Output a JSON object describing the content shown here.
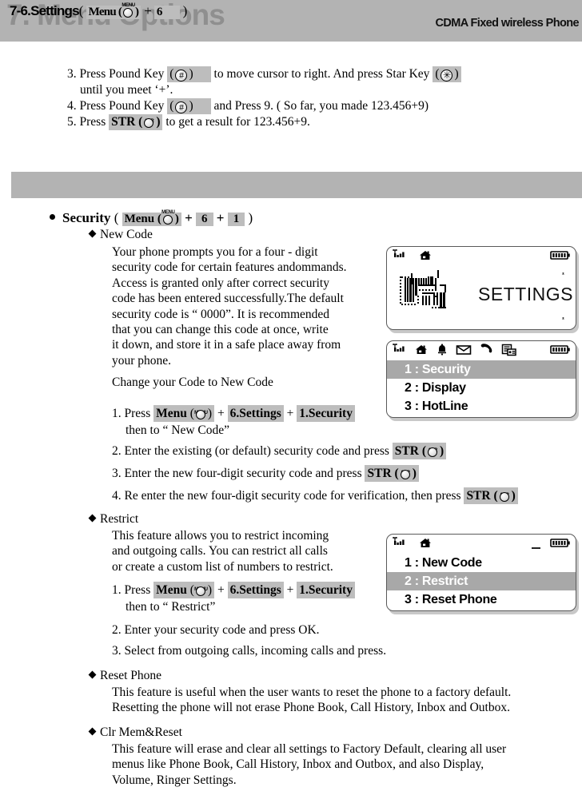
{
  "header": {
    "title": "7. Menu Options",
    "subtitle": "CDMA Fixed wireless Phone",
    "bar_color": "#b3b3b3",
    "title_color": "#8f8f8f"
  },
  "top_steps": {
    "step3_a": "3. Press Pound Key",
    "step3_b": "to move cursor to right.  And press Star Key",
    "step3_cont": "until you meet ‘+’.",
    "step4_a": "4. Press Pound Key",
    "step4_b": "and Press 9. ( So far, you made 123.456+9)",
    "step5_a": "5. Press",
    "step5_b": "to get a result for 123.456+9.",
    "pound_symbol": "#",
    "star_symbol": "✳",
    "str_label": "STR",
    "str_key_cap": "STR"
  },
  "section_band": {
    "title": "7-6.Settings",
    "open_paren": "(",
    "menu_label": "Menu",
    "menu_key_cap": "MENU",
    "plus": "+",
    "number": "6",
    "close_paren": ")"
  },
  "security": {
    "heading": "Security",
    "open_paren": "(",
    "menu_label": "Menu",
    "menu_key_cap": "MENU",
    "plus": "+",
    "num1": "6",
    "num2": "1",
    "close_paren": ")"
  },
  "new_code": {
    "heading": "New Code",
    "paragraph_lines": [
      "Your phone prompts you for a four - digit",
      "security code for certain features andommands.",
      "Access is granted only after correct security",
      "code has been entered successfully.The default",
      "security code is “ 0000”.  It is recommended",
      "that you can change this code at once, write",
      "it down, and store it in a safe place away from",
      "your phone."
    ],
    "change_line": "Change your Code to New Code",
    "step1_prefix": "1. Press",
    "step1_menu": "Menu",
    "step1_plus": "+",
    "step1_settings": "6.Settings",
    "step1_security": "1.Security",
    "step1_cont": "then to “ New Code”",
    "step2": "2. Enter the existing (or default) security code and press",
    "step3": "3. Enter the new four-digit security code and press",
    "step4": "4. Re enter the new four-digit security code for verification, then press",
    "str_label": "STR",
    "str_key_cap": "STR"
  },
  "restrict": {
    "heading": "Restrict",
    "paragraph_lines": [
      "This feature allows you to restrict incoming",
      "and outgoing calls. You can restrict all calls",
      "or create a custom list of numbers to restrict."
    ],
    "step1_prefix": "1. Press",
    "step1_menu": "Menu",
    "step1_plus": "+",
    "step1_settings": "6.Settings",
    "step1_security": "1.Security",
    "step1_cont": "then to “ Restrict”",
    "step2": "2. Enter your security code and press OK.",
    "step3": "3. Select from outgoing calls, incoming calls and press."
  },
  "reset_phone": {
    "heading": "Reset Phone",
    "paragraph_lines": [
      "This feature is useful when the user wants to reset the phone to a factory default.",
      "Resetting the phone will not erase Phone Book, Call History, Inbox and Outbox."
    ]
  },
  "clr_mem": {
    "heading": "Clr Mem&Reset",
    "paragraph_lines": [
      "This feature will erase and clear all settings to Factory Default, clearing all user",
      "menus like Phone Book, Call History, Inbox and Outbox, and also Display,",
      "Volume, Ringer Settings."
    ]
  },
  "lcd_settings": {
    "title_text": "SETTINGS",
    "icons": [
      "signal-icon",
      "home-icon",
      "battery-icon"
    ],
    "tools_icon": "settings-tools-icon"
  },
  "lcd_menu_1": {
    "icons": [
      "signal-icon",
      "home-icon",
      "bell-icon",
      "envelope-icon",
      "handset-icon",
      "fax-icon",
      "battery-icon"
    ],
    "rows": [
      {
        "label": "1 : Security",
        "selected": true
      },
      {
        "label": "2 : Display",
        "selected": false
      },
      {
        "label": "3 : HotLine",
        "selected": false
      }
    ],
    "highlight_color": "#a8a8a8"
  },
  "lcd_menu_2": {
    "icons": [
      "signal-icon",
      "home-icon",
      "battery-icon"
    ],
    "rows": [
      {
        "label": "1 : New Code",
        "selected": false
      },
      {
        "label": "2 : Restrict",
        "selected": true
      },
      {
        "label": "3 : Reset Phone",
        "selected": false
      }
    ],
    "highlight_color": "#a8a8a8"
  }
}
